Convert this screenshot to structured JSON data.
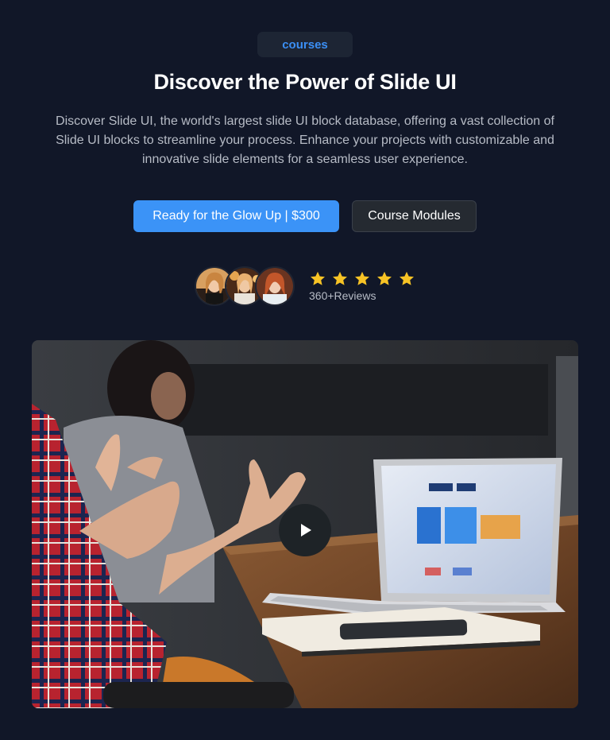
{
  "badge": {
    "label": "courses"
  },
  "hero": {
    "title": "Discover the Power of Slide UI",
    "description": "Discover Slide UI, the world's largest slide UI block database, offering a vast collection of Slide UI blocks to streamline your process. Enhance your projects with customizable and innovative slide elements for a seamless user experience."
  },
  "buttons": {
    "primary_label": "Ready for the Glow Up | $300",
    "secondary_label": "Course Modules"
  },
  "reviews": {
    "rating_stars": 5,
    "label": "360+Reviews"
  },
  "colors": {
    "background": "#111728",
    "accent": "#3b93f7",
    "star": "#f7c325"
  },
  "media": {
    "play_icon": "play-icon"
  }
}
